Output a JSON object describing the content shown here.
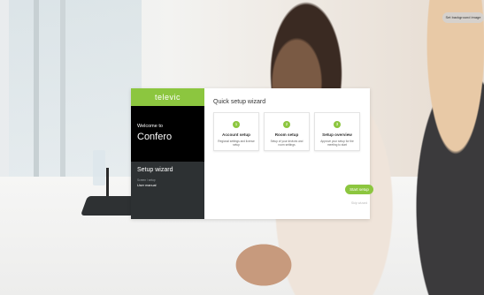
{
  "background": {
    "set_button_label": "Set background image",
    "colors": {
      "accent": "#8cc63f",
      "sidebar_dark": "#2d3133"
    }
  },
  "sidebar": {
    "logo": "televic",
    "welcome_line": "Welcome to",
    "product_name": "Confero",
    "nav_title": "Setup wizard",
    "nav_subtitle": "Screen / setup",
    "nav_link": "User manual"
  },
  "main": {
    "title": "Quick setup wizard",
    "cards": [
      {
        "number": "1",
        "title": "Account setup",
        "desc": "Regional settings and license setup"
      },
      {
        "number": "2",
        "title": "Room setup",
        "desc": "Setup of your devices and room settings"
      },
      {
        "number": "3",
        "title": "Setup overview",
        "desc": "Approve your setup for the meeting to start"
      }
    ],
    "start_button": "Start setup",
    "skip_link": "Skip wizard"
  }
}
